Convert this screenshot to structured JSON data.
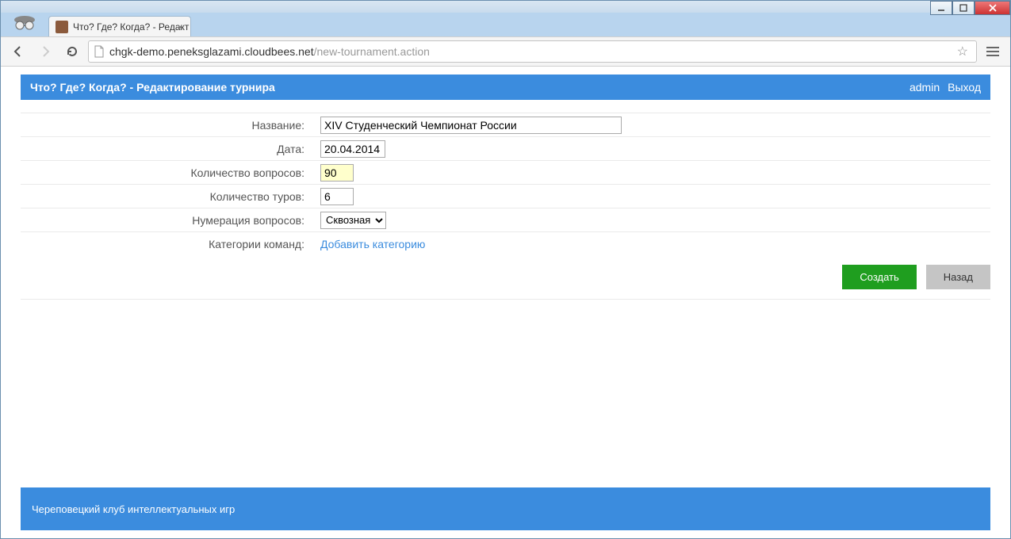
{
  "window": {
    "tab_title": "Что? Где? Когда? - Редакт"
  },
  "address": {
    "host": "chgk-demo.peneksglazami.cloudbees.net",
    "path": "/new-tournament.action"
  },
  "header": {
    "title": "Что? Где? Когда? - Редактирование турнира",
    "user_link": "admin",
    "logout_link": "Выход"
  },
  "form": {
    "labels": {
      "name": "Название:",
      "date": "Дата:",
      "questions": "Количество вопросов:",
      "rounds": "Количество туров:",
      "numbering": "Нумерация вопросов:",
      "categories": "Категории команд:"
    },
    "values": {
      "name": "XIV Студенческий Чемпионат России",
      "date": "20.04.2014",
      "questions": "90",
      "rounds": "6",
      "numbering": "Сквозная"
    },
    "add_category_link": "Добавить категорию",
    "submit_label": "Создать",
    "back_label": "Назад"
  },
  "footer": {
    "text": "Череповецкий клуб интеллектуальных игр"
  }
}
